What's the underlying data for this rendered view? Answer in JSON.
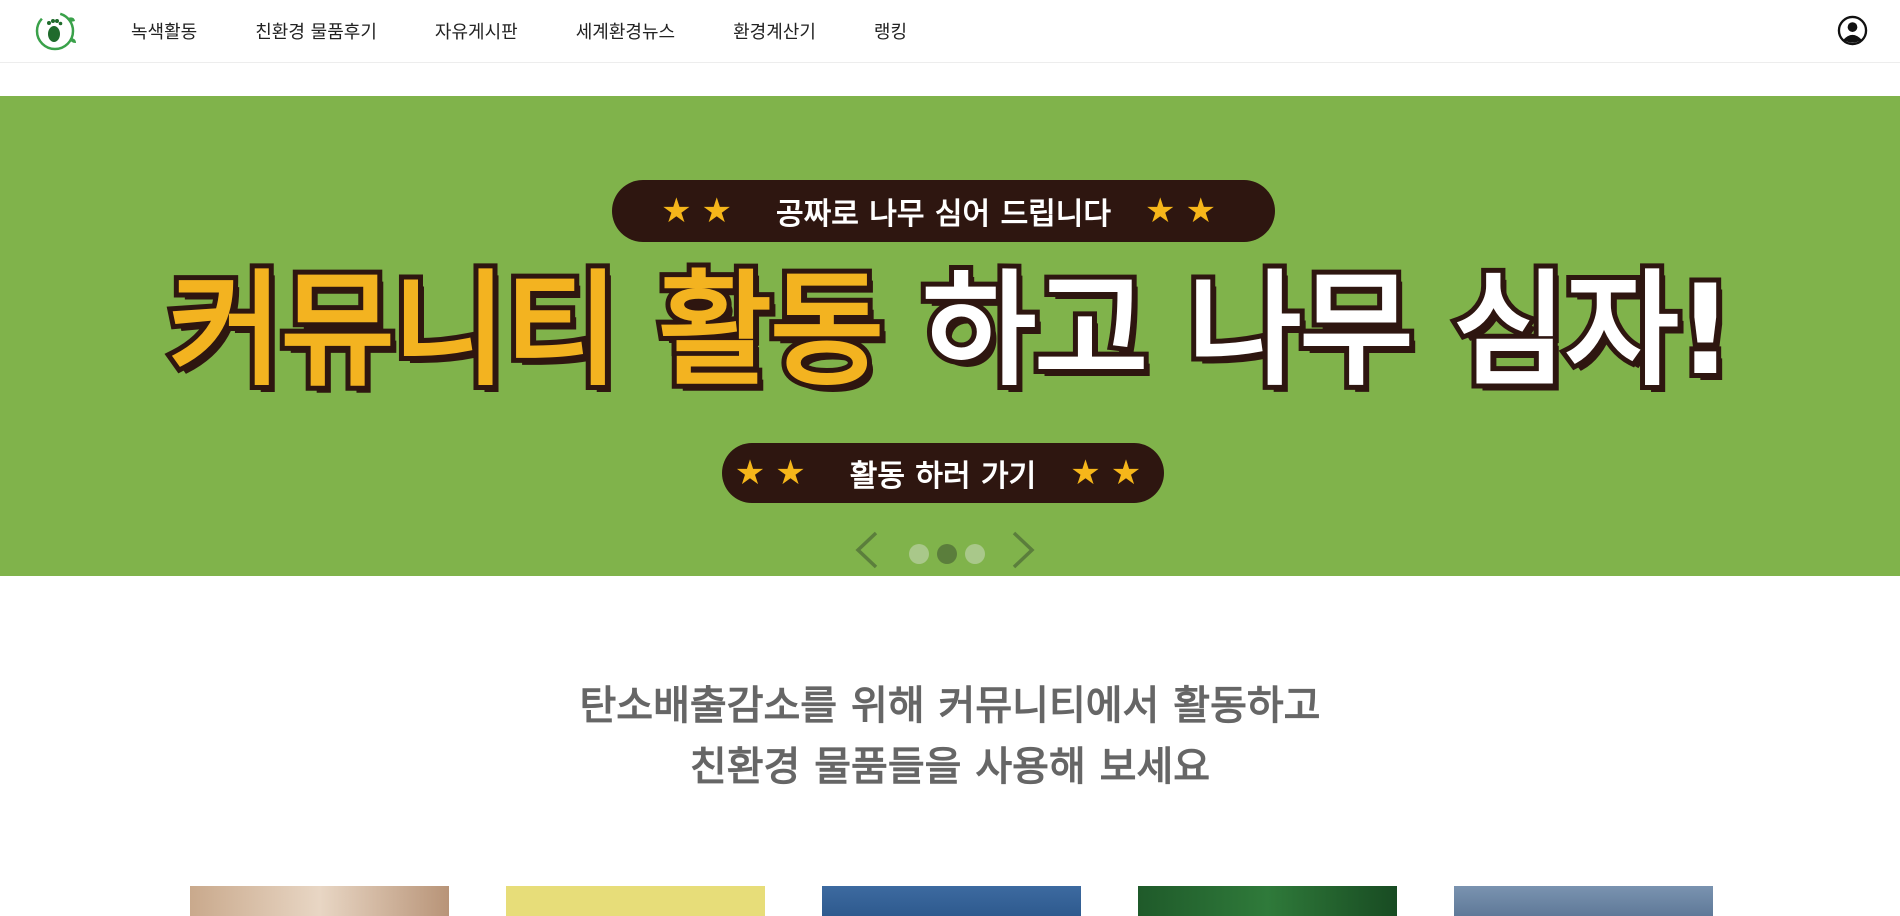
{
  "nav": {
    "menu": [
      "녹색활동",
      "친환경 물품후기",
      "자유게시판",
      "세계환경뉴스",
      "환경계산기",
      "랭킹"
    ]
  },
  "banner": {
    "top_pill": "공짜로 나무 심어 드립니다",
    "headline_highlight": "커뮤니티 활동",
    "headline_rest": "하고 나무 심자!",
    "cta": "활동 하러 가기",
    "background_color": "#80b34b",
    "slides_total": 3,
    "active_slide": 2
  },
  "intro": {
    "line1": "탄소배출감소를 위해 커뮤니티에서 활동하고",
    "line2": "친환경 물품들을 사용해 보세요"
  },
  "colors": {
    "accent_yellow": "#f3b320",
    "dark_brown": "#2e1610",
    "logo_green": "#2e8b3a"
  }
}
